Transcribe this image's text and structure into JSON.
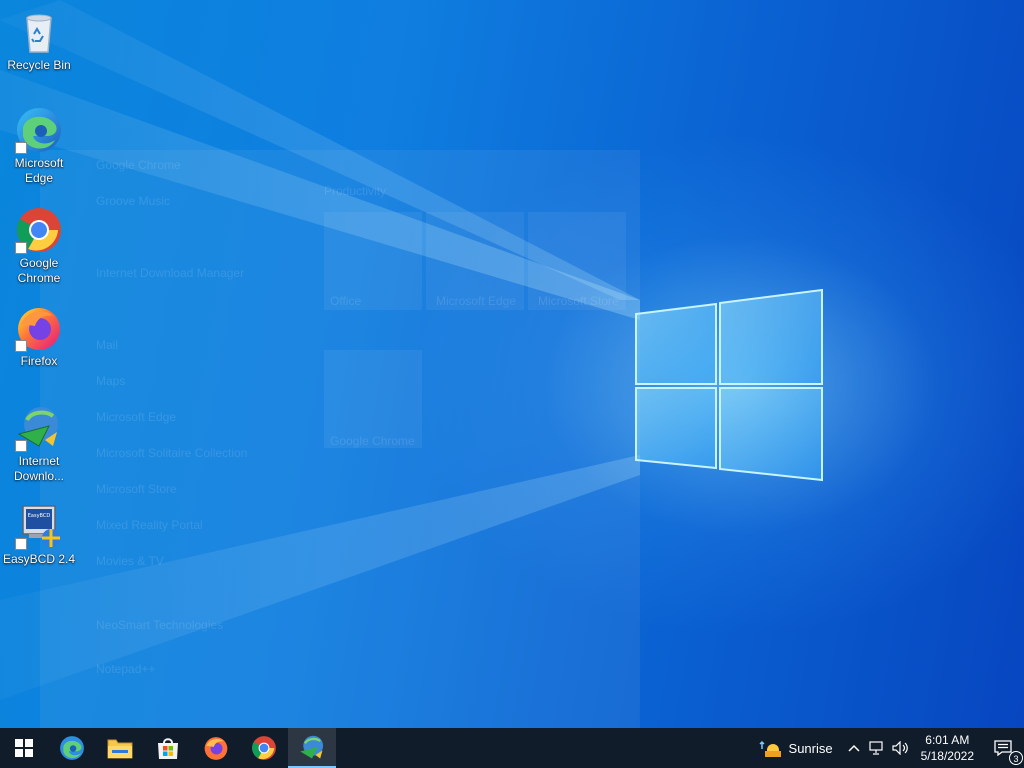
{
  "desktop_icons": [
    {
      "label": "Recycle Bin",
      "icon": "recycle-bin-icon"
    },
    {
      "label": "Microsoft Edge",
      "icon": "edge-icon"
    },
    {
      "label": "Google Chrome",
      "icon": "chrome-icon"
    },
    {
      "label": "Firefox",
      "icon": "firefox-icon"
    },
    {
      "label": "Internet Downlo...",
      "icon": "idm-icon"
    },
    {
      "label": "EasyBCD 2.4",
      "icon": "easybcd-icon"
    }
  ],
  "ghost_start_menu": {
    "apps": [
      "Google Chrome",
      "Groove Music",
      "Internet Download Manager",
      "Mail",
      "Maps",
      "Microsoft Edge",
      "Microsoft Solitaire Collection",
      "Microsoft Store",
      "Mixed Reality Portal",
      "Movies & TV",
      "NeoSmart Technologies",
      "Notepad++"
    ],
    "section_title": "Productivity",
    "tiles": [
      "Office",
      "Microsoft Edge",
      "Microsoft Store",
      "Google Chrome"
    ]
  },
  "taskbar": {
    "pinned": [
      {
        "name": "start",
        "icon": "windows-start-icon"
      },
      {
        "name": "edge",
        "icon": "edge-icon"
      },
      {
        "name": "file-explorer",
        "icon": "folder-icon"
      },
      {
        "name": "store",
        "icon": "store-icon"
      },
      {
        "name": "firefox",
        "icon": "firefox-icon"
      },
      {
        "name": "chrome",
        "icon": "chrome-icon"
      },
      {
        "name": "idm",
        "icon": "idm-icon",
        "active": true
      }
    ],
    "weather": {
      "icon": "sunrise-icon",
      "label": "Sunrise"
    },
    "tray_icons": [
      "chevron-up-icon",
      "network-icon",
      "volume-icon"
    ],
    "clock": {
      "time": "6:01 AM",
      "date": "5/18/2022"
    },
    "notifications": {
      "count": "3",
      "icon": "action-center-icon"
    }
  },
  "colors": {
    "taskbar": "#101c2a",
    "desktop_primary": "#0a86dc",
    "desktop_secondary": "#0746c0",
    "logo_glow": "#8ce1ff"
  }
}
